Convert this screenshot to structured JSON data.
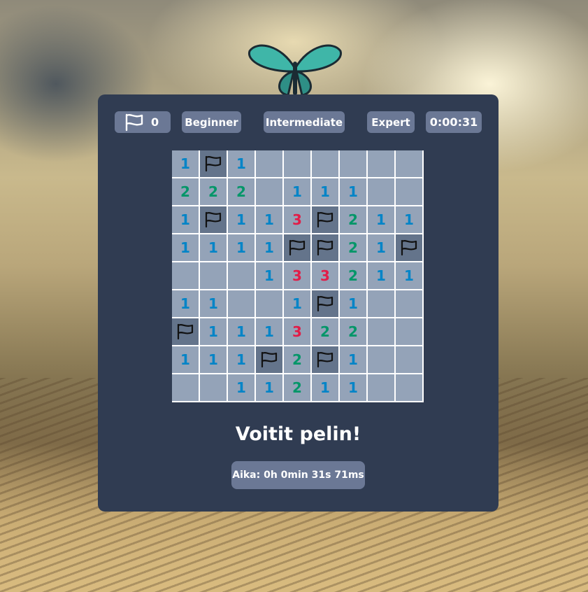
{
  "toolbar": {
    "flag_count": "0",
    "beginner_label": "Beginner",
    "intermediate_label": "Intermediate",
    "expert_label": "Expert",
    "timer": "0:00:31"
  },
  "board": {
    "rows": [
      [
        "1",
        "F",
        "1",
        "",
        "",
        "",
        "",
        "",
        ""
      ],
      [
        "2",
        "2",
        "2",
        "",
        "1",
        "1",
        "1",
        "",
        ""
      ],
      [
        "1",
        "F",
        "1",
        "1",
        "3",
        "F",
        "2",
        "1",
        "1"
      ],
      [
        "1",
        "1",
        "1",
        "1",
        "F",
        "F",
        "2",
        "1",
        "F"
      ],
      [
        "",
        "",
        "",
        "1",
        "3",
        "3",
        "2",
        "1",
        "1"
      ],
      [
        "1",
        "1",
        "",
        "",
        "1",
        "F",
        "1",
        "",
        ""
      ],
      [
        "F",
        "1",
        "1",
        "1",
        "3",
        "2",
        "2",
        "",
        ""
      ],
      [
        "1",
        "1",
        "1",
        "F",
        "2",
        "F",
        "1",
        "",
        ""
      ],
      [
        "",
        "",
        "1",
        "1",
        "2",
        "1",
        "1",
        "",
        ""
      ]
    ]
  },
  "result": {
    "title": "Voitit pelin!",
    "time_text": "Aika: 0h 0min 31s 71ms"
  },
  "icons": {
    "flag": "flag-icon",
    "butterfly": "butterfly-icon"
  },
  "colors": {
    "panel": "#303c52",
    "button": "#6b7895",
    "cell": "#94a3b8",
    "cell_flagged": "#64748b",
    "num1": "#0284c7",
    "num2": "#059669",
    "num3": "#e11d48"
  }
}
